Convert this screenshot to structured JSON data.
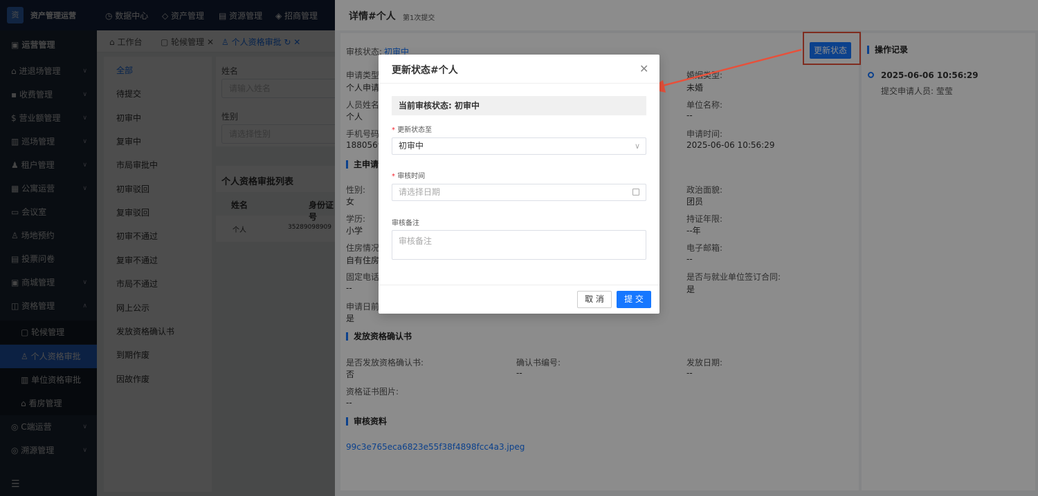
{
  "app": {
    "logo_text": "资",
    "name": "资产管理运营"
  },
  "topnav": [
    "数据中心",
    "资产管理",
    "资源管理",
    "招商管理"
  ],
  "sidebar": {
    "items": [
      {
        "label": "运营管理",
        "chev": ""
      },
      {
        "label": "进退场管理",
        "chev": "∨"
      },
      {
        "label": "收费管理",
        "chev": "∨"
      },
      {
        "label": "营业额管理",
        "chev": "∨"
      },
      {
        "label": "巡场管理",
        "chev": "∨"
      },
      {
        "label": "租户管理",
        "chev": "∨"
      },
      {
        "label": "公寓运营",
        "chev": "∨"
      },
      {
        "label": "会议室",
        "chev": ""
      },
      {
        "label": "场地预约",
        "chev": ""
      },
      {
        "label": "投票问卷",
        "chev": ""
      },
      {
        "label": "商城管理",
        "chev": "∨"
      },
      {
        "label": "资格管理",
        "chev": "∧"
      },
      {
        "label": "轮候管理",
        "chev": ""
      },
      {
        "label": "个人资格审批",
        "chev": ""
      },
      {
        "label": "单位资格审批",
        "chev": ""
      },
      {
        "label": "看房管理",
        "chev": ""
      },
      {
        "label": "C端运营",
        "chev": "∨"
      },
      {
        "label": "溯源管理",
        "chev": "∨"
      }
    ],
    "collapse_icon": "☰"
  },
  "tabs": [
    {
      "label": "工作台"
    },
    {
      "label": "轮候管理"
    },
    {
      "label": "个人资格审批"
    }
  ],
  "status_list": [
    "全部",
    "待提交",
    "初审中",
    "复审中",
    "市局审批中",
    "初审驳回",
    "复审驳回",
    "初审不通过",
    "复审不通过",
    "市局不通过",
    "网上公示",
    "发放资格确认书",
    "到期作废",
    "因故作废"
  ],
  "filter": {
    "name_label": "姓名",
    "name_placeholder": "请输入姓名",
    "gender_label": "性别",
    "gender_placeholder": "请选择性别"
  },
  "list": {
    "title": "个人资格审批列表",
    "headers": [
      "姓名",
      "身份证号"
    ],
    "row": {
      "name": "个人",
      "id": "35289098909"
    }
  },
  "drawer": {
    "title": "详情#个人",
    "subtitle": "第1次提交",
    "status_label": "审核状态:",
    "status_value": "初审中",
    "update_button": "更新状态",
    "fields": {
      "apply_type_label": "申请类型:",
      "apply_type_value": "个人申请",
      "person_name_label": "人员姓名:",
      "person_name_value": "个人",
      "phone_label": "手机号码:",
      "phone_value": "18805697",
      "marital_label": "婚姻类型:",
      "marital_value": "未婚",
      "company_label": "单位名称:",
      "company_value": "--",
      "apply_time_label": "申请时间:",
      "apply_time_value": "2025-06-06 10:56:29",
      "gender_label": "性别:",
      "gender_value": "女",
      "political_label": "政治面貌:",
      "political_value": "团员",
      "edu_label": "学历:",
      "edu_value": "小学",
      "cert_years_label": "持证年限:",
      "cert_years_value": "--年",
      "housing_label": "住房情况:",
      "housing_value": "自有住房",
      "email_label": "电子邮箱:",
      "email_value": "--",
      "landline_label": "固定电话:",
      "landline_value": "--",
      "contract_label": "是否与就业单位签订合同:",
      "contract_value": "是",
      "before_label": "申请日前",
      "before_value": "是"
    },
    "section_main": "主申请人",
    "section_cert": "发放资格确认书",
    "cert": {
      "issued_label": "是否发放资格确认书:",
      "issued_value": "否",
      "number_label": "确认书编号:",
      "number_value": "--",
      "date_label": "发放日期:",
      "date_value": "--",
      "image_label": "资格证书图片:",
      "image_value": "--"
    },
    "section_docs": "审核资料",
    "doc_link": "99c3e765eca6823e55f38f4898fcc4a3.jpeg",
    "oplog": {
      "title": "操作记录",
      "time": "2025-06-06 10:56:29",
      "desc": "提交申请人员: 莹莹"
    }
  },
  "modal": {
    "title": "更新状态#个人",
    "current_status": "当前审核状态: 初审中",
    "update_to_label": "更新状态至",
    "update_to_value": "初审中",
    "review_time_label": "审核时间",
    "review_time_placeholder": "请选择日期",
    "note_label": "审核备注",
    "note_placeholder": "审核备注",
    "cancel": "取 消",
    "submit": "提 交"
  },
  "colors": {
    "accent": "#1677ff",
    "annotation": "#e8503a",
    "sidebar": "#1f2d3d"
  }
}
